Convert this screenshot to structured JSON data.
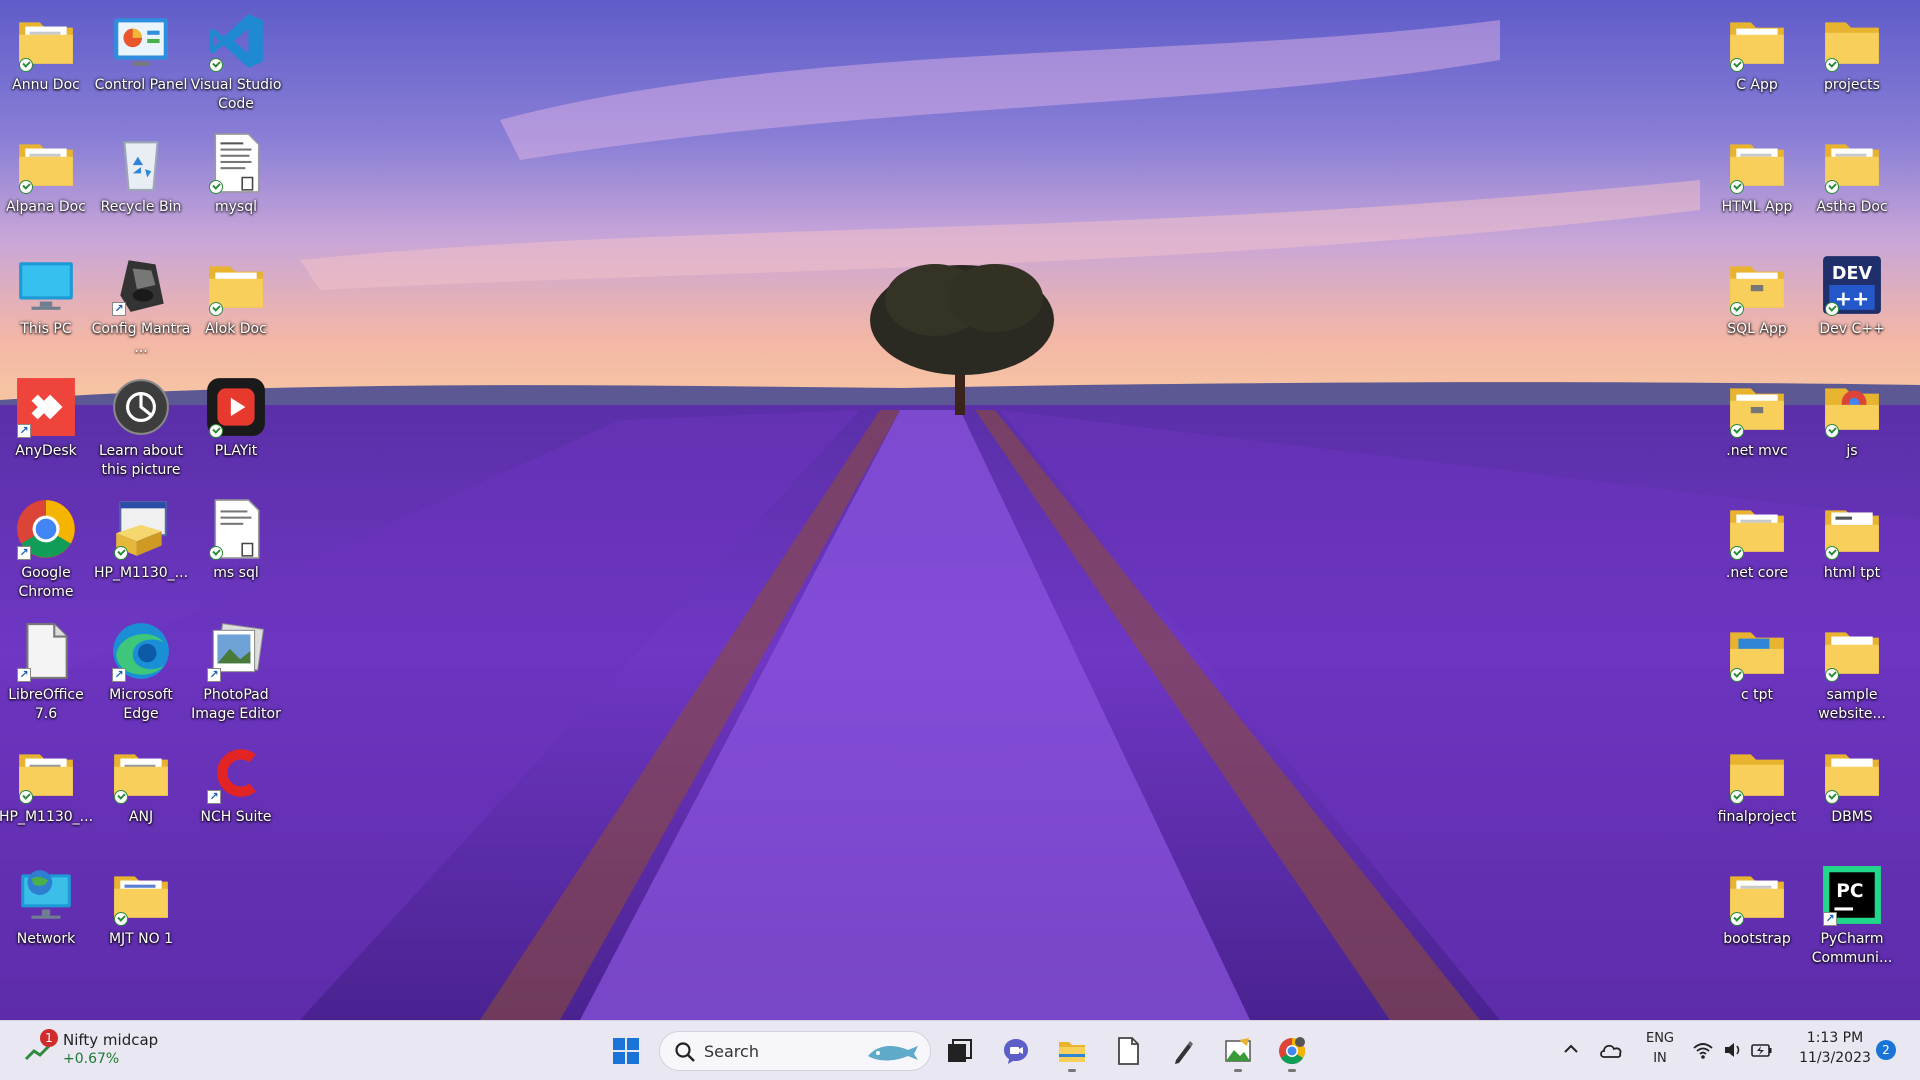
{
  "desktop": {
    "icons": [
      {
        "label": "Annu Doc",
        "icon": "folder-docs-icon",
        "sync": true,
        "shortcut": false
      },
      {
        "label": "Control Panel",
        "icon": "control-panel-icon",
        "sync": false,
        "shortcut": false
      },
      {
        "label": "Visual Studio Code",
        "icon": "vscode-icon",
        "sync": true,
        "shortcut": false
      },
      {
        "label": "Alpana Doc",
        "icon": "folder-docs-icon",
        "sync": true,
        "shortcut": false
      },
      {
        "label": "Recycle Bin",
        "icon": "recycle-bin-icon",
        "sync": false,
        "shortcut": false
      },
      {
        "label": "mysql",
        "icon": "text-file-icon",
        "sync": true,
        "shortcut": false
      },
      {
        "label": "This PC",
        "icon": "monitor-icon",
        "sync": false,
        "shortcut": false
      },
      {
        "label": "Config Mantra ...",
        "icon": "config-mantra-icon",
        "sync": false,
        "shortcut": true
      },
      {
        "label": "Alok Doc",
        "icon": "folder-icon",
        "sync": true,
        "shortcut": false
      },
      {
        "label": "AnyDesk",
        "icon": "anydesk-icon",
        "sync": false,
        "shortcut": true
      },
      {
        "label": "Learn about this picture",
        "icon": "camera-info-icon",
        "sync": false,
        "shortcut": false
      },
      {
        "label": "PLAYit",
        "icon": "playit-icon",
        "sync": true,
        "shortcut": false
      },
      {
        "label": "Google Chrome",
        "icon": "chrome-icon",
        "sync": false,
        "shortcut": true
      },
      {
        "label": "HP_M1130_...",
        "icon": "hp-installer-icon",
        "sync": true,
        "shortcut": false
      },
      {
        "label": "ms sql",
        "icon": "text-file-icon",
        "sync": true,
        "shortcut": false
      },
      {
        "label": "LibreOffice 7.6",
        "icon": "libreoffice-icon",
        "sync": false,
        "shortcut": true
      },
      {
        "label": "Microsoft Edge",
        "icon": "edge-icon",
        "sync": false,
        "shortcut": true
      },
      {
        "label": "PhotoPad Image Editor",
        "icon": "photopad-icon",
        "sync": false,
        "shortcut": true
      },
      {
        "label": "HP_M1130_...",
        "icon": "folder-docs-icon",
        "sync": true,
        "shortcut": false
      },
      {
        "label": "ANJ",
        "icon": "folder-docs-icon",
        "sync": true,
        "shortcut": false
      },
      {
        "label": "NCH Suite",
        "icon": "nch-icon",
        "sync": false,
        "shortcut": true
      },
      {
        "label": "Network",
        "icon": "network-icon",
        "sync": false,
        "shortcut": false
      },
      {
        "label": "MJT NO 1",
        "icon": "folder-docs-icon",
        "sync": true,
        "shortcut": false
      },
      {
        "label": "C App",
        "icon": "folder-icon",
        "sync": true,
        "shortcut": false
      },
      {
        "label": "projects",
        "icon": "folder-icon",
        "sync": true,
        "shortcut": false
      },
      {
        "label": "HTML App",
        "icon": "folder-docs-icon",
        "sync": true,
        "shortcut": false
      },
      {
        "label": "Astha Doc",
        "icon": "folder-docs-icon",
        "sync": true,
        "shortcut": false
      },
      {
        "label": "SQL App",
        "icon": "folder-icon",
        "sync": true,
        "shortcut": false
      },
      {
        "label": "Dev C++",
        "icon": "devcpp-icon",
        "sync": true,
        "shortcut": false
      },
      {
        "label": ".net mvc",
        "icon": "folder-icon",
        "sync": true,
        "shortcut": false
      },
      {
        "label": "js",
        "icon": "folder-chrome-icon",
        "sync": true,
        "shortcut": false
      },
      {
        "label": ".net core",
        "icon": "folder-docs-icon",
        "sync": true,
        "shortcut": false
      },
      {
        "label": "html tpt",
        "icon": "folder-docs-icon",
        "sync": true,
        "shortcut": false
      },
      {
        "label": "c tpt",
        "icon": "folder-app-icon",
        "sync": true,
        "shortcut": false
      },
      {
        "label": "sample website...",
        "icon": "folder-docs-icon",
        "sync": true,
        "shortcut": false
      },
      {
        "label": "finalproject",
        "icon": "folder-icon",
        "sync": true,
        "shortcut": false
      },
      {
        "label": "DBMS",
        "icon": "folder-docs-icon",
        "sync": true,
        "shortcut": false
      },
      {
        "label": "bootstrap",
        "icon": "folder-docs-icon",
        "sync": true,
        "shortcut": false
      },
      {
        "label": "PyCharm Communi...",
        "icon": "pycharm-icon",
        "sync": false,
        "shortcut": true
      }
    ]
  },
  "taskbar": {
    "widget": {
      "title": "Nifty midcap",
      "change": "+0.67%",
      "badge": "1"
    },
    "search": {
      "placeholder": "Search"
    },
    "apps": [
      {
        "name": "start-button",
        "icon": "windows-logo-icon"
      },
      {
        "name": "task-view-button",
        "icon": "task-view-icon"
      },
      {
        "name": "teams-chat-button",
        "icon": "chat-icon"
      },
      {
        "name": "file-explorer-button",
        "icon": "folder-icon"
      },
      {
        "name": "notepad-button",
        "icon": "notepad-icon"
      },
      {
        "name": "pen-tool-button",
        "icon": "pen-icon"
      },
      {
        "name": "photo-app-button",
        "icon": "photo-app-icon"
      },
      {
        "name": "chrome-button",
        "icon": "chrome-icon"
      }
    ],
    "tray": {
      "lang_top": "ENG",
      "lang_bottom": "IN",
      "time": "1:13 PM",
      "date": "11/3/2023",
      "notifications": "2"
    }
  }
}
